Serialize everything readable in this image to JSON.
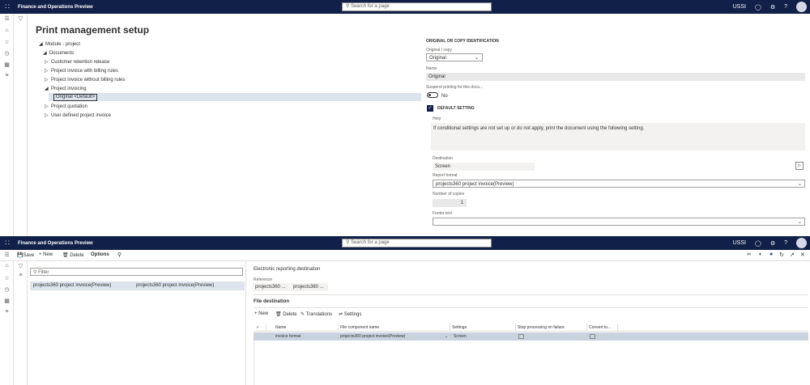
{
  "top_app": {
    "app_name": "Finance and Operations Preview",
    "search_placeholder": "Search for a page",
    "company": "USSI",
    "help": "?"
  },
  "page1": {
    "title": "Print management setup",
    "tree": {
      "module": "Module - project",
      "documents": "Documents",
      "items": [
        "Customer retention release",
        "Project invoice with billing rules",
        "Project invoice without billing rules",
        "Project invoicing"
      ],
      "selected": "Original <Default>",
      "items_after": [
        "Project quotation",
        "User defined project invoice"
      ]
    },
    "detail": {
      "section_title": "ORIGINAL OR COPY IDENTIFICATION",
      "orig_copy_label": "Original / copy",
      "orig_copy_value": "Original",
      "name_label": "Name",
      "name_value": "Original",
      "suspend_label": "Suspend printing for this docu...",
      "suspend_value": "No",
      "default_setting": "DEFAULT SETTING",
      "help_label": "Help",
      "help_text": "If conditional settings are not set up or do not apply, print the document using the following setting.",
      "destination_label": "Destination",
      "destination_value": "Screen",
      "report_format_label": "Report format",
      "report_format_value": "projects360 project invoice(Preview)",
      "copies_label": "Number of copies",
      "copies_value": "1",
      "footer_label": "Footer text"
    }
  },
  "page2": {
    "toolbar": {
      "save": "Save",
      "new": "New",
      "delete": "Delete",
      "options": "Options"
    },
    "filter_placeholder": "Filter",
    "list": [
      {
        "col1": "projects360 project invoice(Preview)",
        "col2": "projects360 project invoice(Preview)"
      }
    ],
    "erd_title": "Electronic reporting destination",
    "reference_label": "Reference",
    "reference_values": [
      "projects360 ...",
      "projects360 ..."
    ],
    "file_destination": "File destination",
    "grid_toolbar": {
      "new": "New",
      "delete": "Delete",
      "translations": "Translations",
      "settings": "Settings"
    },
    "grid_headers": [
      "Name",
      "File component name",
      "Settings",
      "Stop processing on failure",
      "Convert to..."
    ],
    "grid_rows": [
      {
        "name": "invoice format",
        "component": "projects360 project invoice(Preview)",
        "settings": "Screen"
      }
    ]
  }
}
